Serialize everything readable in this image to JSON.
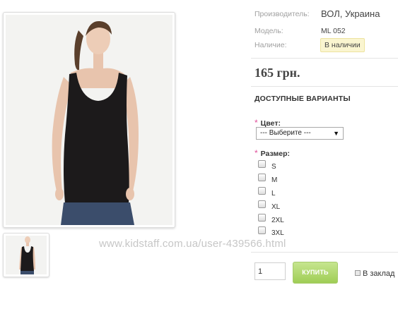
{
  "product": {
    "manufacturer": {
      "label": "Производитель:",
      "value": "ВОЛ, Украина"
    },
    "model": {
      "label": "Модель:",
      "value": "ML 052"
    },
    "availability": {
      "label": "Наличие:",
      "value": "В наличии"
    },
    "price": "165 грн."
  },
  "options": {
    "title": "ДОСТУПНЫЕ ВАРИАНТЫ",
    "required_mark": "*",
    "color": {
      "label": "Цвет:",
      "selected": "--- Выберите ---",
      "arrow": "▼"
    },
    "size": {
      "label": "Размер:",
      "values": [
        "S",
        "M",
        "L",
        "XL",
        "2XL",
        "3XL"
      ]
    }
  },
  "purchase": {
    "quantity": "1",
    "buy_label": "КУПИТЬ",
    "bookmark_label": "В заклад"
  },
  "watermark": "www.kidstaff.com.ua/user-439566.html",
  "colors": {
    "buy_button": "#9fcd55",
    "stock_badge": "#faf5d0",
    "required_mark": "#e0509a"
  },
  "icons": {
    "select_arrow": "chevron-down-icon",
    "bookmark": "bookmark-icon"
  }
}
